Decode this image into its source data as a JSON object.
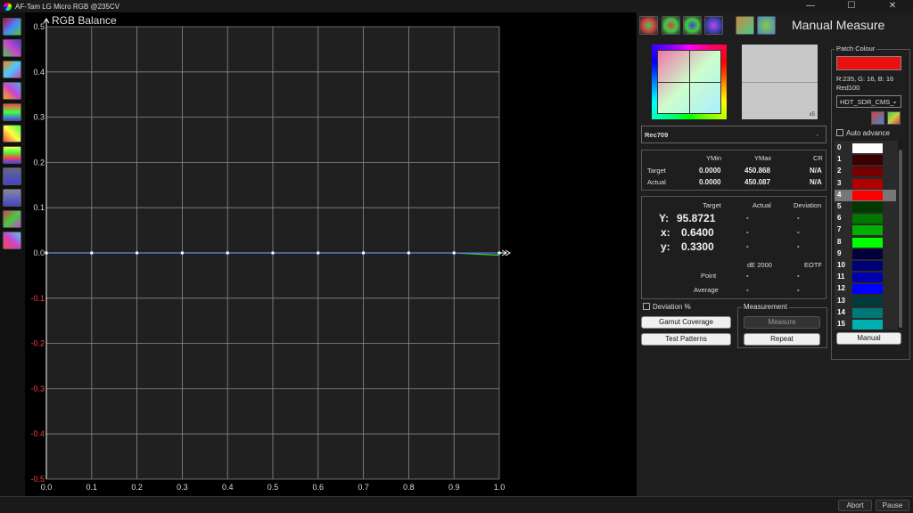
{
  "window": {
    "title": "AF-Tam LG Micro RGB @235CV",
    "min": "—",
    "max": "☐",
    "close": "✕"
  },
  "chart_data": {
    "type": "line",
    "title": "RGB Balance",
    "x": [
      0.0,
      0.1,
      0.2,
      0.3,
      0.4,
      0.5,
      0.6,
      0.7,
      0.8,
      0.9,
      1.0
    ],
    "xlim": [
      0,
      1
    ],
    "ylim": [
      -0.5,
      0.5
    ],
    "x_ticks": [
      "0.0",
      "0.1",
      "0.2",
      "0.3",
      "0.4",
      "0.5",
      "0.6",
      "0.7",
      "0.8",
      "0.9",
      "1.0"
    ],
    "y_ticks": [
      "0.5",
      "0.4",
      "0.3",
      "0.2",
      "0.1",
      "0.0",
      "-0.1",
      "-0.2",
      "-0.3",
      "-0.4",
      "-0.5"
    ],
    "series": [
      {
        "color": "#ff3030",
        "values": [
          0,
          0,
          0,
          0,
          0,
          0,
          0,
          0,
          0,
          0,
          0
        ]
      },
      {
        "color": "#30ff30",
        "values": [
          0,
          0,
          0,
          0,
          0,
          0,
          0,
          0,
          0,
          0,
          -0.005
        ]
      },
      {
        "color": "#4060ff",
        "values": [
          0,
          0,
          0,
          0,
          0,
          0,
          0,
          0,
          0,
          0,
          0
        ]
      }
    ],
    "grid": true
  },
  "panel": {
    "title": "Manual Measure",
    "colorspace": "Rec709",
    "colorspace_extra": "-",
    "preview_zoom": "x5",
    "y_table": {
      "headers": [
        "YMin",
        "YMax",
        "CR"
      ],
      "target_label": "Target",
      "actual_label": "Actual",
      "target": [
        "0.0000",
        "450.868",
        "N/A"
      ],
      "actual": [
        "0.0000",
        "450.087",
        "N/A"
      ]
    },
    "meas": {
      "headers": [
        "Target",
        "Actual",
        "Deviation"
      ],
      "Y_label": "Y:",
      "Y": "95.8721",
      "Y_actual": "-",
      "Y_dev": "-",
      "x_label": "x:",
      "x": "0.6400",
      "x_actual": "-",
      "x_dev": "-",
      "y_label": "y:",
      "y": "0.3300",
      "y_actual": "-",
      "y_dev": "-",
      "de_label": "dE 2000",
      "eotf_label": "EOTF",
      "point_label": "Point",
      "point_de": "-",
      "point_eotf": "-",
      "avg_label": "Average",
      "avg_de": "-",
      "avg_eotf": "-"
    },
    "deviation_pct": "Deviation %",
    "gamut_btn": "Gamut Coverage",
    "test_btn": "Test Patterns",
    "measurement_group": "Measurement",
    "measure_btn": "Measure",
    "repeat_btn": "Repeat",
    "patch": {
      "group": "Patch Colour",
      "rgb": "R:235, G: 16, B: 16",
      "name": "Red100",
      "preset": "HDT_SDR_CMS_",
      "auto_advance": "Auto advance",
      "manual_btn": "Manual",
      "swatch": "#eb1010",
      "list": [
        {
          "n": "0",
          "c": "#ffffff"
        },
        {
          "n": "1",
          "c": "#3a0000"
        },
        {
          "n": "2",
          "c": "#780000"
        },
        {
          "n": "3",
          "c": "#b00000"
        },
        {
          "n": "4",
          "c": "#ff0000"
        },
        {
          "n": "5",
          "c": "#003a00"
        },
        {
          "n": "6",
          "c": "#007800"
        },
        {
          "n": "7",
          "c": "#00b000"
        },
        {
          "n": "8",
          "c": "#00ff00"
        },
        {
          "n": "9",
          "c": "#00003a"
        },
        {
          "n": "10",
          "c": "#000078"
        },
        {
          "n": "11",
          "c": "#0000b0"
        },
        {
          "n": "12",
          "c": "#0000ff"
        },
        {
          "n": "13",
          "c": "#003a3a"
        },
        {
          "n": "14",
          "c": "#007878"
        },
        {
          "n": "15",
          "c": "#00b0b0"
        }
      ],
      "selected": 4
    }
  },
  "status": {
    "abort": "Abort",
    "pause": "Pause"
  }
}
